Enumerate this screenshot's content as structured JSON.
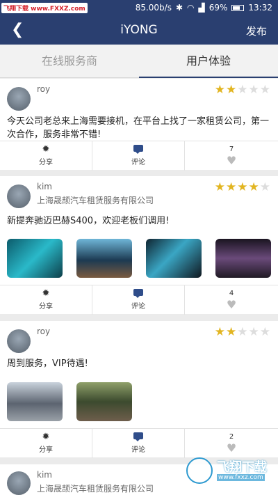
{
  "status": {
    "watermark": "飞翔下载 www.FXXZ.com",
    "speed": "85.00b/s",
    "battery": "69%",
    "time": "13:32"
  },
  "header": {
    "back_icon": "chevron-left-icon",
    "title": "iYONG",
    "action": "发布"
  },
  "tabs": [
    {
      "label": "在线服务商",
      "active": false
    },
    {
      "label": "用户体验",
      "active": true
    }
  ],
  "posts": [
    {
      "user": "roy",
      "company": "",
      "rating": 2,
      "text": "今天公司老总来上海需要接机，在平台上找了一家租赁公司，第一次合作，服务非常不错!",
      "photos": [],
      "share": "分享",
      "comment": "评论",
      "likes": "7"
    },
    {
      "user": "kim",
      "company": "上海晟颉汽车租赁服务有限公司",
      "rating": 4,
      "text": "新提奔驰迈巴赫S400，欢迎老板们调用!",
      "photos": [
        "teal-car-photo",
        "blue-sedan-photo",
        "car-interior-photo",
        "rear-seat-photo"
      ],
      "share": "分享",
      "comment": "评论",
      "likes": "4"
    },
    {
      "user": "roy",
      "company": "",
      "rating": 2,
      "text": "周到服务，VIP待遇!",
      "photos": [
        "fleet-photo",
        "parked-cars-photo"
      ],
      "share": "分享",
      "comment": "评论",
      "likes": "2"
    },
    {
      "user": "kim",
      "company": "上海晟颉汽车租赁服务有限公司"
    }
  ],
  "watermark2": {
    "title": "飞翔下载",
    "url": "www.fxxz.com"
  },
  "colors": {
    "header": "#2a3f70",
    "star": "#e2b521",
    "divider": "#ebebeb"
  }
}
